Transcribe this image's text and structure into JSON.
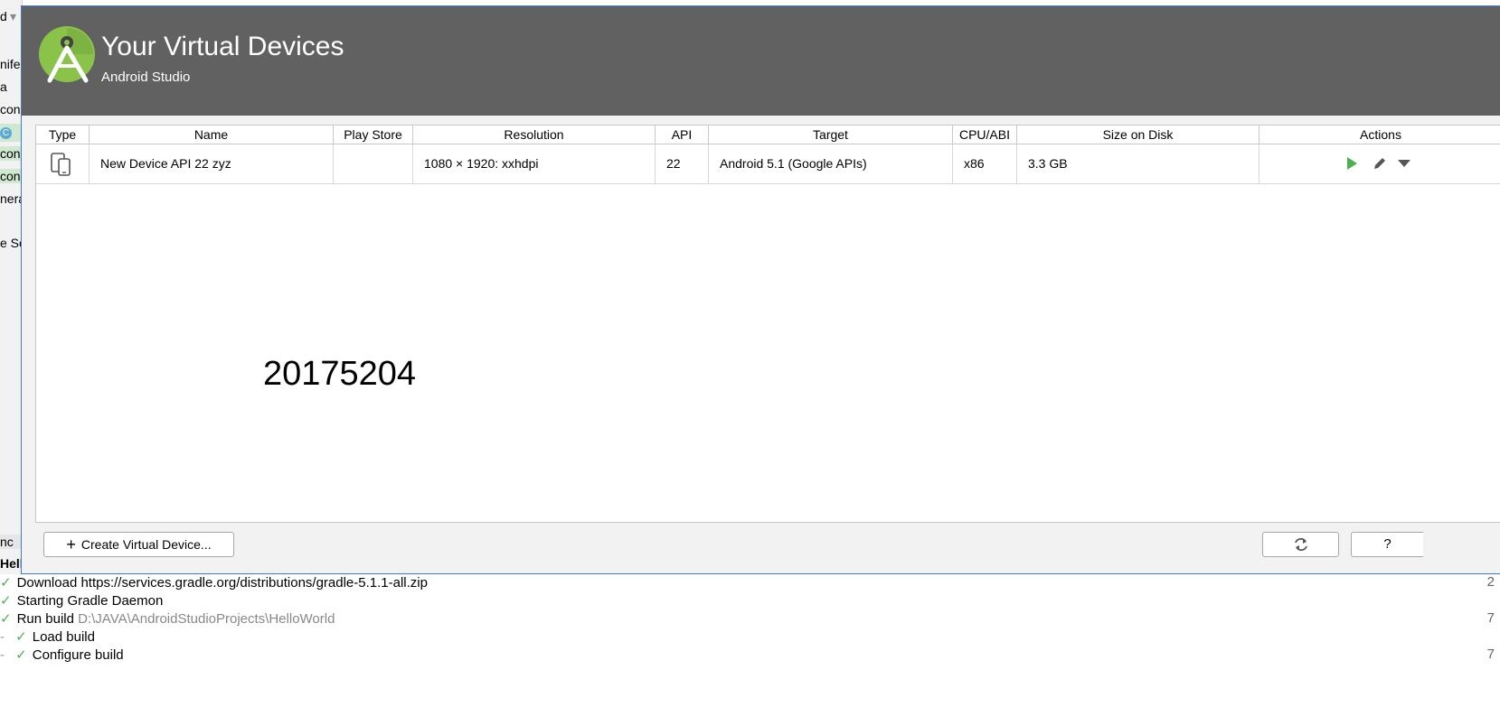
{
  "ide_left": {
    "fragments": [
      "d",
      "nife",
      "a",
      "con",
      "C",
      "con",
      "con",
      "nera",
      "e Sc",
      "nc",
      "Hello"
    ]
  },
  "avd": {
    "title": "Your Virtual Devices",
    "subtitle": "Android Studio",
    "columns": [
      "Type",
      "Name",
      "Play Store",
      "Resolution",
      "API",
      "Target",
      "CPU/ABI",
      "Size on Disk",
      "Actions"
    ],
    "devices": [
      {
        "type_icon": "phone-tablet-icon",
        "name": "New Device API 22 zyz",
        "play_store": "",
        "resolution": "1080 × 1920: xxhdpi",
        "api": "22",
        "target": "Android 5.1 (Google APIs)",
        "cpu_abi": "x86",
        "size": "3.3 GB"
      }
    ],
    "watermark": "20175204",
    "create_button": "Create Virtual Device...",
    "help_button": "?"
  },
  "build_output": {
    "lines": [
      {
        "text": "Download https://services.gradle.org/distributions/gradle-5.1.1-all.zip",
        "path": "",
        "right": "2"
      },
      {
        "text": "Starting Gradle Daemon",
        "path": "",
        "right": ""
      },
      {
        "text": "Run build",
        "path": "D:\\JAVA\\AndroidStudioProjects\\HelloWorld",
        "right": "7"
      },
      {
        "text": "Load build",
        "path": "",
        "right": ""
      },
      {
        "text": "Configure build",
        "path": "",
        "right": "7"
      }
    ]
  },
  "colors": {
    "header_bg": "#616161",
    "play_green": "#4caf50",
    "check_green": "#4caf50",
    "logo_green": "#8bc34a"
  }
}
